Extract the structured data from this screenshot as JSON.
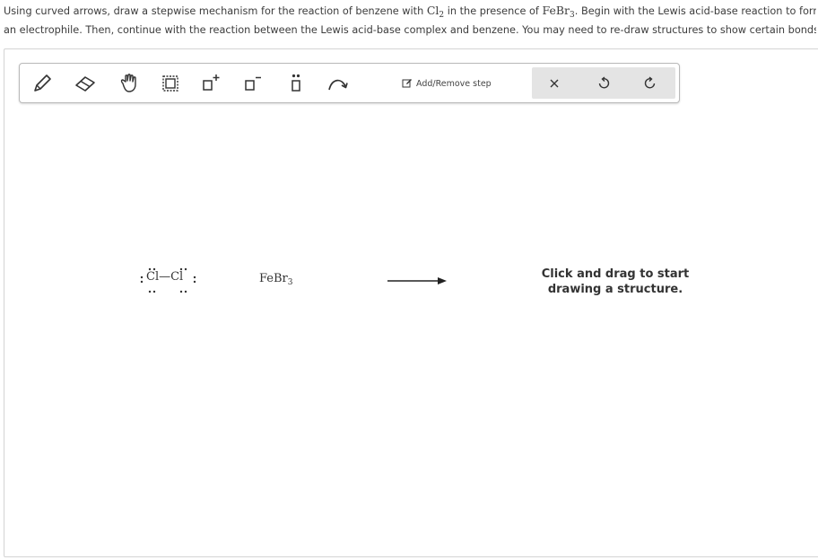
{
  "question": {
    "part1": "Using curved arrows, draw a stepwise mechanism for the reaction of benzene with ",
    "cl_base": "Cl",
    "cl_sub": "2",
    "part2": " in the presence of ",
    "fe_base": "FeBr",
    "fe_sub": "3",
    "part3": ". Begin with the Lewis acid-base reaction to form",
    "line2": "an electrophile. Then, continue with the reaction between the Lewis acid-base complex and benzene. You may need to re-draw structures to show certain bonds."
  },
  "toolbar": {
    "tools": [
      "pencil-icon",
      "eraser-icon",
      "hand-icon",
      "selection-icon",
      "positive-charge-icon",
      "negative-charge-icon",
      "lone-pair-icon",
      "curved-arrow-icon"
    ],
    "add_step_label": "Add/Remove step",
    "actions": [
      "close-icon",
      "undo-icon",
      "redo-icon"
    ]
  },
  "canvas": {
    "molecule1_left": "Cl",
    "molecule1_bond": "—",
    "molecule1_right": "Cl",
    "molecule2_base": "FeBr",
    "molecule2_sub": "3",
    "hint_line1": "Click and drag to start",
    "hint_line2": "drawing a structure."
  }
}
